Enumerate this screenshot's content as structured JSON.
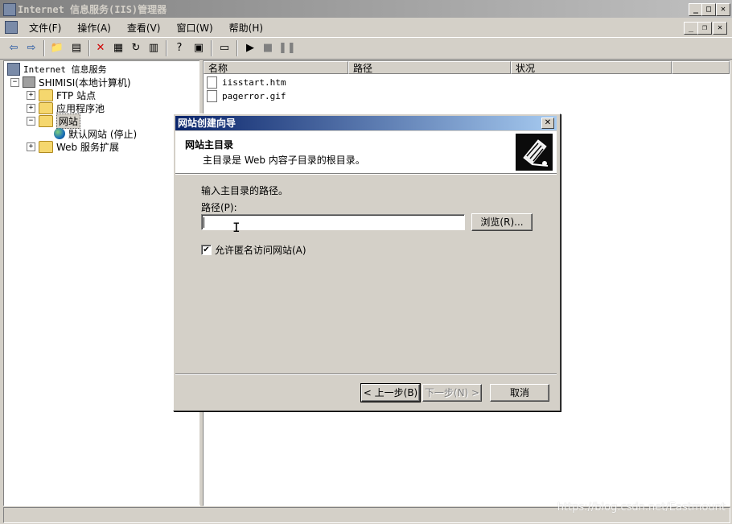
{
  "window": {
    "title": "Internet 信息服务(IIS)管理器",
    "controls": [
      "_",
      "□",
      "✕"
    ]
  },
  "menu": [
    "文件(F)",
    "操作(A)",
    "查看(V)",
    "窗口(W)",
    "帮助(H)"
  ],
  "tree": {
    "root": "Internet 信息服务",
    "server": "SHIMISI(本地计算机)",
    "ftp": "FTP 站点",
    "apppools": "应用程序池",
    "websites": "网站",
    "default_site": "默认网站 (停止)",
    "webext": "Web 服务扩展"
  },
  "list": {
    "columns": [
      "名称",
      "路径",
      "状况"
    ],
    "files": [
      "iisstart.htm",
      "pagerror.gif"
    ]
  },
  "dialog": {
    "title": "网站创建向导",
    "close": "✕",
    "header_title": "网站主目录",
    "header_subtitle": "主目录是 Web 内容子目录的根目录。",
    "instruction": "输入主目录的路径。",
    "path_label": "路径(P):",
    "path_value": "",
    "browse_button": "浏览(R)...",
    "anonymous_checkbox_label": "允许匿名访问网站(A)",
    "anonymous_checked": true,
    "back_button": "< 上一步(B)",
    "next_button": "下一步(N) >",
    "cancel_button": "取消"
  },
  "watermark": "https://blog.csdn.net/Eastmount"
}
